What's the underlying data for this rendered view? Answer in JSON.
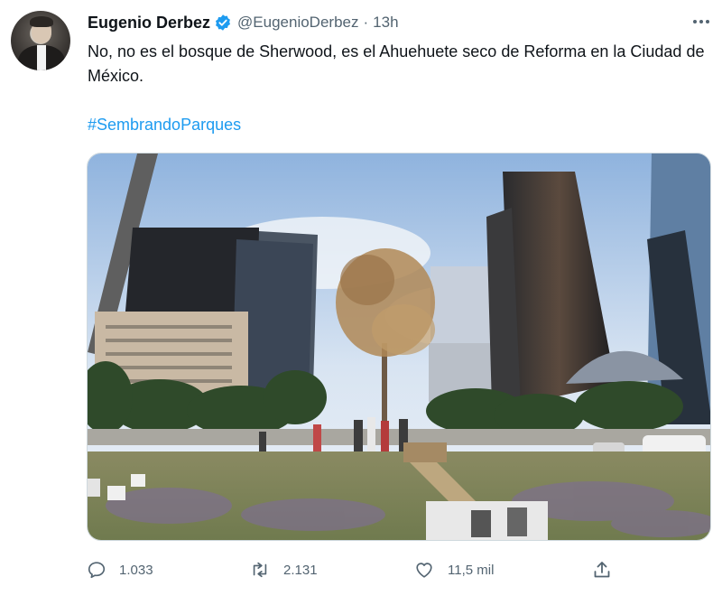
{
  "tweet": {
    "author": {
      "display_name": "Eugenio Derbez",
      "handle": "@EugenioDerbez",
      "verified": true
    },
    "separator": "·",
    "time": "13h",
    "text": "No, no es el bosque de Sherwood, es el Ahuehuete seco de Reforma en la Ciudad de México.",
    "hashtag": "#SembrandoParques",
    "media": {
      "type": "photo",
      "icon": "photo-of-dry-tree-among-skyscrapers"
    },
    "actions": {
      "reply_count": "1.033",
      "retweet_count": "2.131",
      "like_count": "11,5 mil"
    }
  },
  "colors": {
    "accent": "#1d9bf0",
    "text": "#0f1419",
    "secondary": "#536471",
    "verified": "#1d9bf0"
  },
  "icons": [
    "verified-badge-icon",
    "more-icon",
    "reply-icon",
    "retweet-icon",
    "like-icon",
    "share-icon"
  ]
}
